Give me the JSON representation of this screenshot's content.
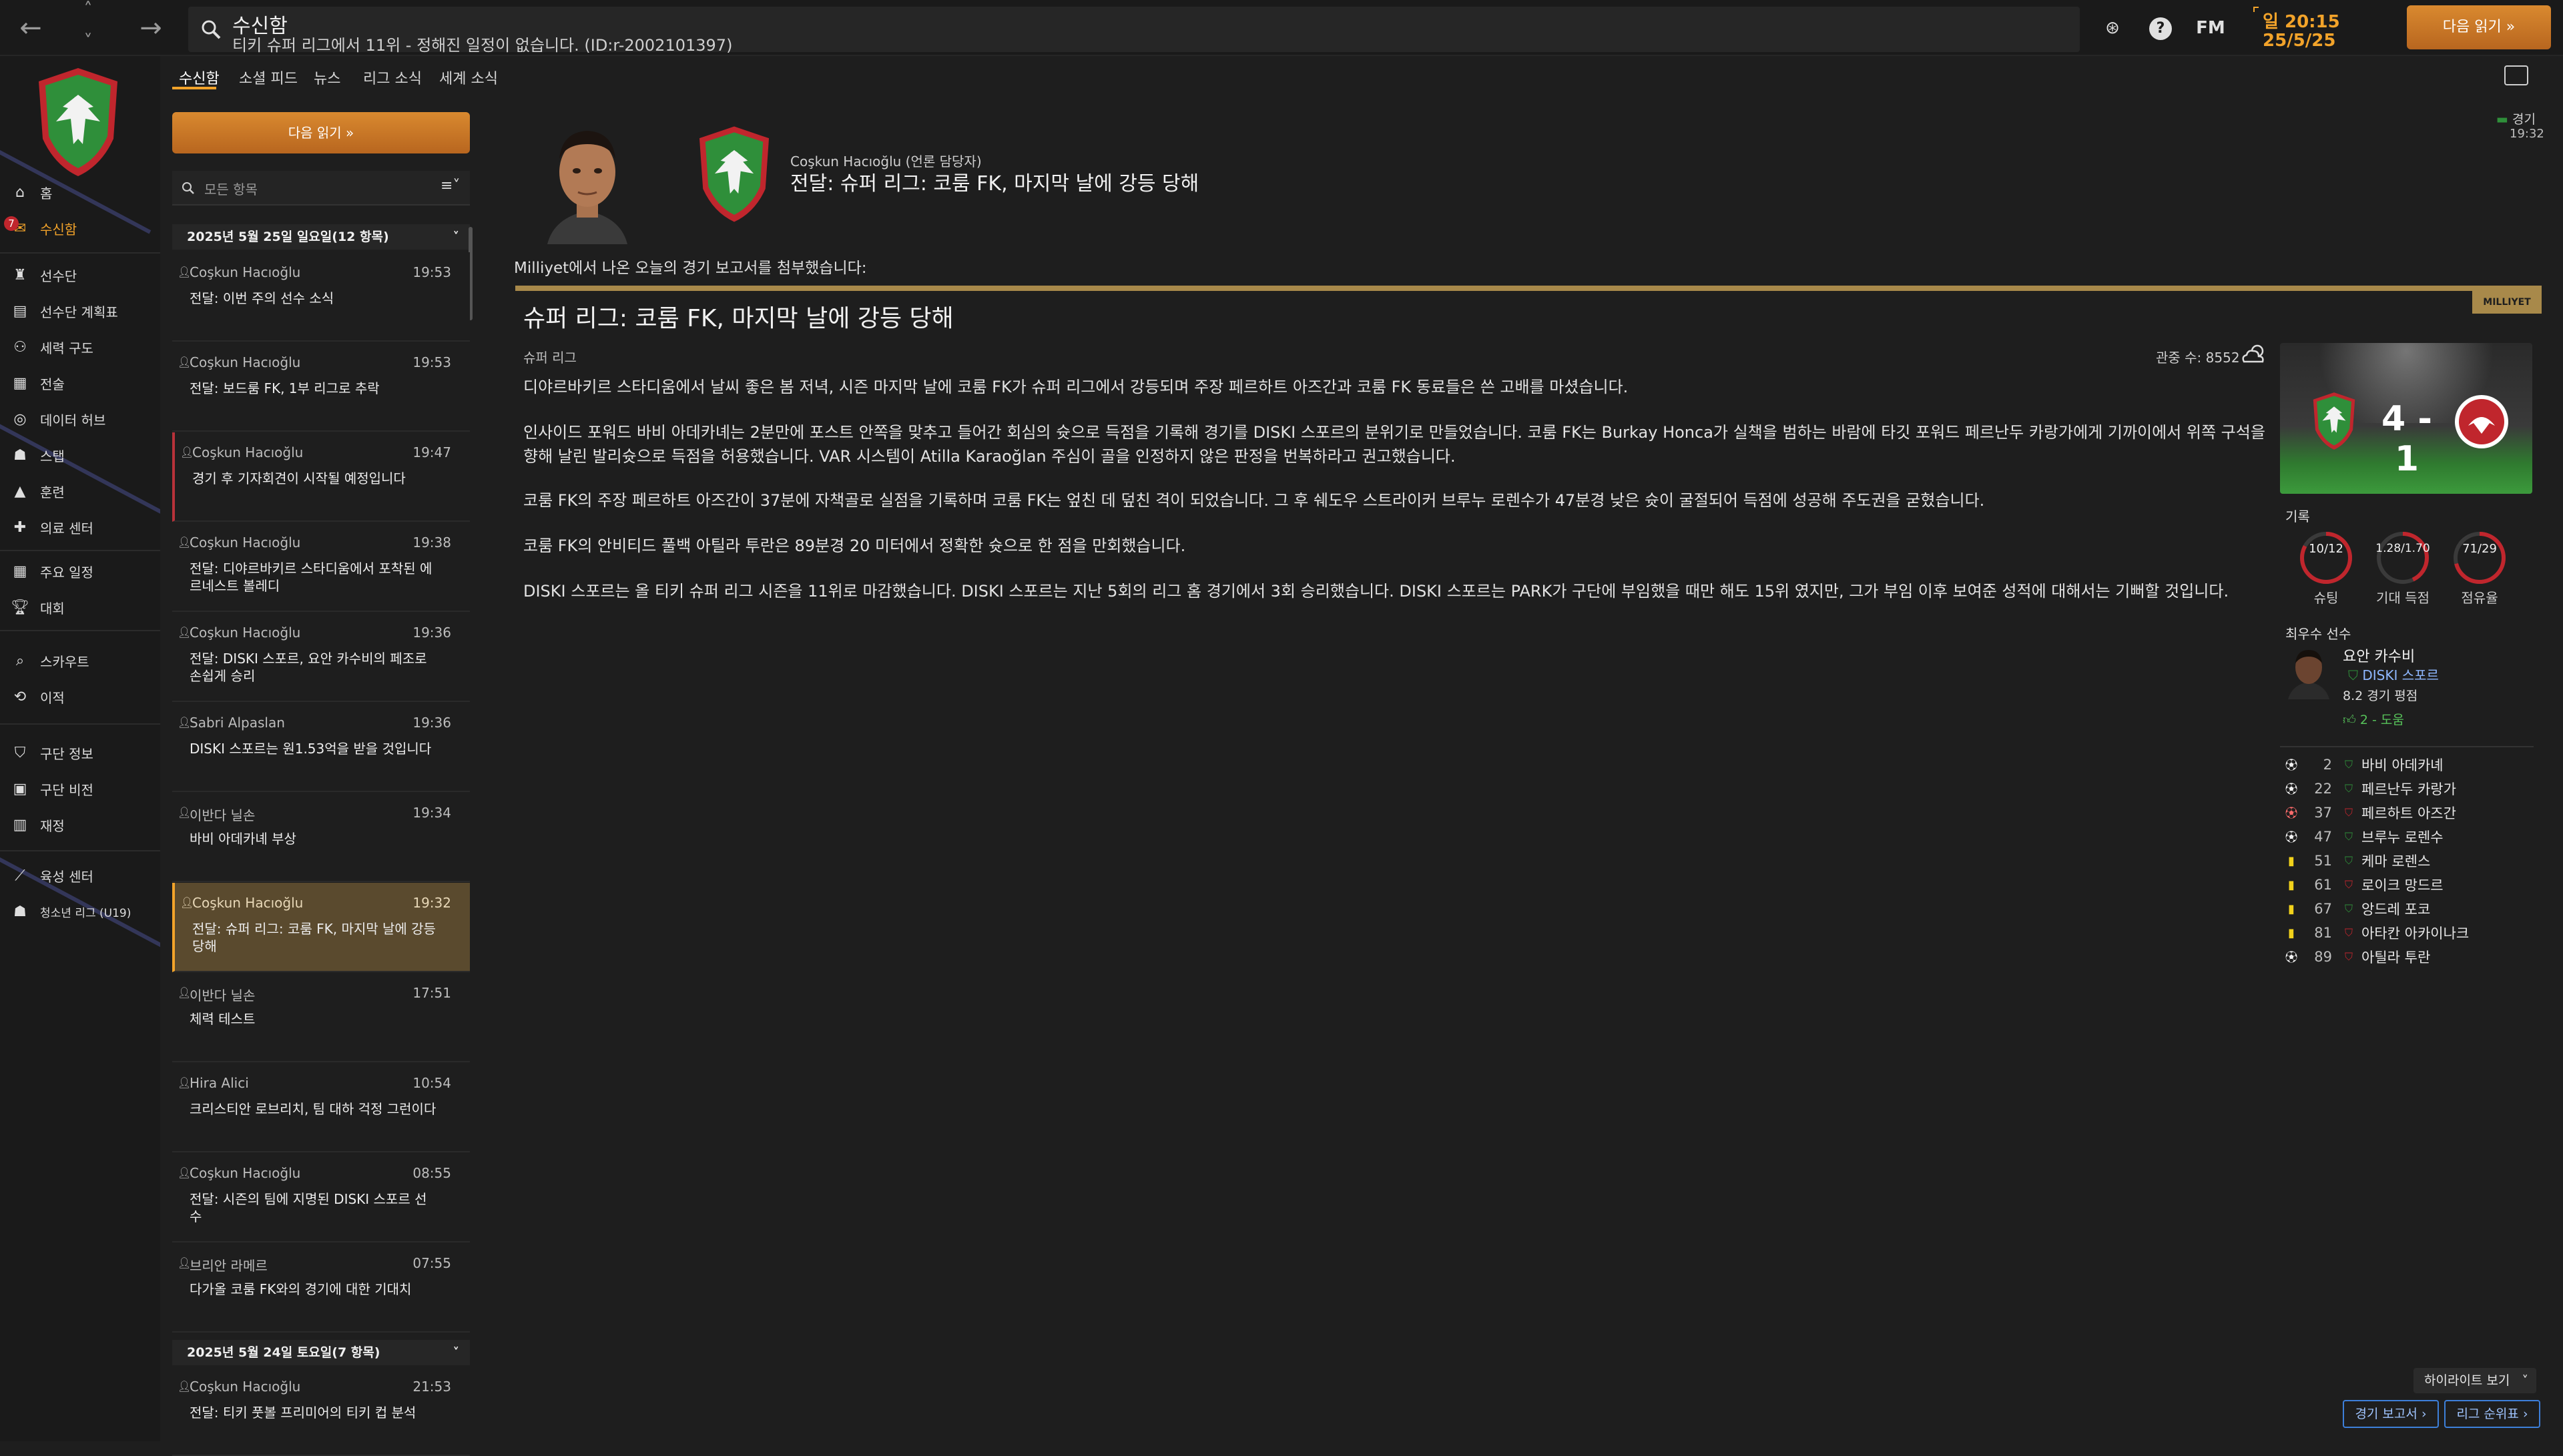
{
  "topbar": {
    "title": "수신함",
    "subtitle": "티키 슈퍼 리그에서 11위 - 정해진 일정이 없습니다. (ID:r-2002101397)",
    "clock_time": "일 20:15",
    "clock_date": "25/5/25",
    "next_button": "다음 읽기",
    "fm_label": "FM"
  },
  "sidebar": {
    "badge_count": "7",
    "items": [
      {
        "label": "홈",
        "icon": "home-icon"
      },
      {
        "label": "수신함",
        "icon": "inbox-icon"
      },
      {
        "label": "선수단",
        "icon": "shirt-icon"
      },
      {
        "label": "선수단 계획표",
        "icon": "clipboard-icon"
      },
      {
        "label": "세력 구도",
        "icon": "dynamics-icon"
      },
      {
        "label": "전술",
        "icon": "tactics-icon"
      },
      {
        "label": "데이터 허브",
        "icon": "data-hub-icon"
      },
      {
        "label": "스탭",
        "icon": "staff-icon"
      },
      {
        "label": "훈련",
        "icon": "training-icon"
      },
      {
        "label": "의료 센터",
        "icon": "medical-icon"
      },
      {
        "label": "주요 일정",
        "icon": "calendar-icon"
      },
      {
        "label": "대회",
        "icon": "trophy-icon"
      },
      {
        "label": "스카우트",
        "icon": "scouting-icon"
      },
      {
        "label": "이적",
        "icon": "transfer-icon"
      },
      {
        "label": "구단 정보",
        "icon": "shield-icon"
      },
      {
        "label": "구단 비전",
        "icon": "vision-icon"
      },
      {
        "label": "재정",
        "icon": "finance-icon"
      },
      {
        "label": "육성 센터",
        "icon": "development-icon"
      },
      {
        "label": "청소년 리그 (U19)",
        "icon": "youth-icon"
      }
    ]
  },
  "tabs": [
    "수신함",
    "소셜 피드",
    "뉴스",
    "리그 소식",
    "세계 소식"
  ],
  "inbox": {
    "next_button": "다음 읽기",
    "filter_placeholder": "모든 항목",
    "group1": "2025년 5월 25일 일요일(12 항목)",
    "group2": "2025년 5월 24일 토요일(7 항목)",
    "messages": [
      {
        "from": "Coşkun Hacıoğlu",
        "time": "19:53",
        "subject": "전달: 이번 주의 선수 소식"
      },
      {
        "from": "Coşkun Hacıoğlu",
        "time": "19:53",
        "subject": "전달: 보드룸 FK, 1부 리그로 추락"
      },
      {
        "from": "Coşkun Hacıoğlu",
        "time": "19:47",
        "subject": "경기 후 기자회견이 시작될 예정입니다"
      },
      {
        "from": "Coşkun Hacıoğlu",
        "time": "19:38",
        "subject": "전달: 디야르바키르 스타디움에서 포착된 에르네스트 볼레디"
      },
      {
        "from": "Coşkun Hacıoğlu",
        "time": "19:36",
        "subject": "전달: DISKI 스포르, 요안 카수비의 페조로 손쉽게 승리"
      },
      {
        "from": "Sabri Alpaslan",
        "time": "19:36",
        "subject": "DISKI 스포르는 원1.53억을 받을 것입니다"
      },
      {
        "from": "이반다 닐손",
        "time": "19:34",
        "subject": "바비 아데카녜 부상"
      },
      {
        "from": "Coşkun Hacıoğlu",
        "time": "19:32",
        "subject": "전달: 슈퍼 리그: 코룸 FK, 마지막 날에 강등 당해"
      },
      {
        "from": "이반다 닐손",
        "time": "17:51",
        "subject": "체력 테스트"
      },
      {
        "from": "Hira Alici",
        "time": "10:54",
        "subject": "크리스티안 로브리치, 팀 대하 걱정 그런이다"
      },
      {
        "from": "Coşkun Hacıoğlu",
        "time": "08:55",
        "subject": "전달: 시즌의 팀에 지명된 DISKI 스포르 선수"
      },
      {
        "from": "브리안 라메르",
        "time": "07:55",
        "subject": "다가올 코룸 FK와의 경기에 대한 기대치"
      },
      {
        "from": "Coşkun Hacıoğlu",
        "time": "21:53",
        "subject": "전달: 티키 풋볼 프리미어의 티키 컵 분석"
      }
    ]
  },
  "article": {
    "sender": "Coşkun Hacıoğlu",
    "sender_role": "(언론 담당자)",
    "header_title": "전달: 슈퍼 리그: 코룸 FK, 마지막 날에 강등 당해",
    "status_label": "경기",
    "status_time": "19:32",
    "intro": "Milliyet에서 나온 오늘의 경기 보고서를 첨부했습니다:",
    "source_tag": "MILLIYET",
    "headline": "슈퍼 리그: 코룸 FK, 마지막 날에 강등 당해",
    "competition": "슈퍼 리그",
    "attendance": "관중 수: 8552",
    "paragraphs": [
      "디야르바키르 스타디움에서 날씨 좋은 봄 저녁, 시즌 마지막 날에 코룸 FK가 슈퍼 리그에서 강등되며 주장 페르하트 아즈간과 코룸 FK 동료들은 쓴 고배를 마셨습니다.",
      "인사이드 포워드 바비 아데카녜는 2분만에 포스트 안쪽을 맞추고 들어간 회심의 슛으로 득점을 기록해 경기를 DISKI 스포르의 분위기로 만들었습니다. 코룸 FK는 Burkay Honca가 실책을 범하는 바람에 타깃 포워드 페르난두 카랑가에게 기까이에서 위쪽 구석을 향해 날린 발리슛으로 득점을 허용했습니다. VAR 시스템이 Atilla Karaoğlan 주심이 골을 인정하지 않은 판정을 번복하라고 권고했습니다.",
      "코룸 FK의 주장 페르하트 아즈간이 37분에 자책골로 실점을 기록하며 코룸 FK는 엎친 데 덮친 격이 되었습니다. 그 후 쉐도우 스트라이커 브루누 로렌수가 47분경 낮은 슛이 굴절되어 득점에 성공해 주도권을 굳혔습니다.",
      "코룸 FK의 안비티드 풀백 아틸라 투란은 89분경 20 미터에서 정확한 슛으로 한 점을 만회했습니다.",
      "DISKI 스포르는 올 티키 슈퍼 리그 시즌을 11위로 마감했습니다. DISKI 스포르는 지난 5회의 리그 홈 경기에서 3회 승리했습니다. DISKI 스포르는 PARK가 구단에 부임했을 때만 해도 15위 였지만, 그가 부임 이후 보여준 성적에 대해서는 기뻐할 것입니다."
    ]
  },
  "match": {
    "home_score": "4",
    "away_score": "1",
    "score_sep": "-",
    "stats_title": "기록",
    "stats": [
      {
        "value": "10/12",
        "label": "슈팅",
        "fraction": 0.83
      },
      {
        "value": "1.28/1.70",
        "label": "기대 득점",
        "fraction": 0.43
      },
      {
        "value": "71/29",
        "label": "점유율",
        "fraction": 0.71
      }
    ],
    "mvp_title": "최우수 선수",
    "mvp_name": "요안 카수비",
    "mvp_club": "DISKI 스포르",
    "mvp_rating": "8.2 경기 평점",
    "mvp_contrib": "2 - 도움",
    "events": [
      {
        "icon": "goal-icon",
        "minute": "2",
        "team": "home",
        "player": "바비 아데카녜"
      },
      {
        "icon": "goal-icon",
        "minute": "22",
        "team": "home",
        "player": "페르난두 카랑가"
      },
      {
        "icon": "own-goal-icon",
        "minute": "37",
        "team": "away",
        "player": "페르하트 아즈간"
      },
      {
        "icon": "goal-icon",
        "minute": "47",
        "team": "home",
        "player": "브루누 로렌수"
      },
      {
        "icon": "yellow-card-icon",
        "minute": "51",
        "team": "home",
        "player": "케마 로렌스"
      },
      {
        "icon": "yellow-card-icon",
        "minute": "61",
        "team": "away",
        "player": "로이크 망드르"
      },
      {
        "icon": "yellow-card-icon",
        "minute": "67",
        "team": "home",
        "player": "앙드레 포코"
      },
      {
        "icon": "yellow-card-icon",
        "minute": "81",
        "team": "away",
        "player": "아타칸 아카이나크"
      },
      {
        "icon": "goal-icon",
        "minute": "89",
        "team": "away",
        "player": "아틸라 투란"
      }
    ],
    "highlights_button": "하이라이트 보기",
    "report_button": "경기 보고서",
    "league_table_button": "리그 순위표"
  },
  "colors": {
    "accent": "#f2a32a",
    "home_green": "#2f8f3a",
    "away_red": "#c0262d"
  }
}
